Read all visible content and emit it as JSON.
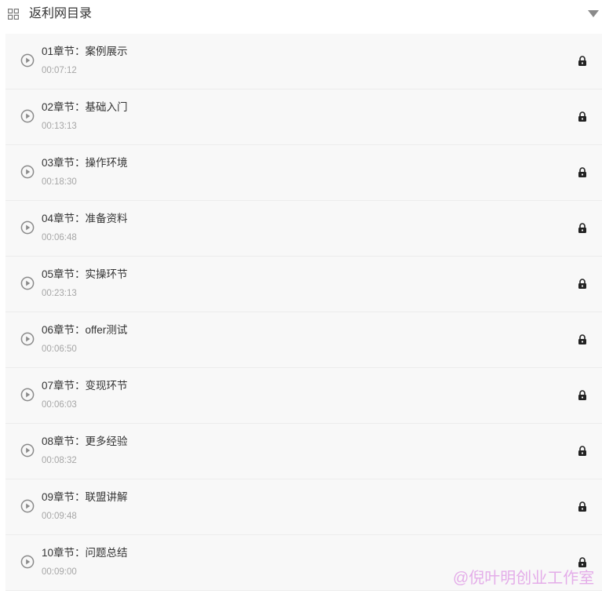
{
  "header": {
    "title": "返利网目录",
    "icon": "grid-icon",
    "toggle_icon": "caret-down-icon"
  },
  "chapters": [
    {
      "title": "01章节：案例展示",
      "duration": "00:07:12",
      "locked": true
    },
    {
      "title": "02章节：基础入门",
      "duration": "00:13:13",
      "locked": true
    },
    {
      "title": "03章节：操作环境",
      "duration": "00:18:30",
      "locked": true
    },
    {
      "title": "04章节：准备资料",
      "duration": "00:06:48",
      "locked": true
    },
    {
      "title": "05章节：实操环节",
      "duration": "00:23:13",
      "locked": true
    },
    {
      "title": "06章节：offer测试",
      "duration": "00:06:50",
      "locked": true
    },
    {
      "title": "07章节：变现环节",
      "duration": "00:06:03",
      "locked": true
    },
    {
      "title": "08章节：更多经验",
      "duration": "00:08:32",
      "locked": true
    },
    {
      "title": "09章节：联盟讲解",
      "duration": "00:09:48",
      "locked": true
    },
    {
      "title": "10章节：问题总结",
      "duration": "00:09:00",
      "locked": true
    }
  ],
  "watermark": "@倪叶明创业工作室",
  "colors": {
    "row_background": "#f8f8f8",
    "title_text": "#333333",
    "duration_text": "#a6a6a6",
    "icon_gray": "#8a8a8a",
    "watermark": "#e1a0e6"
  }
}
